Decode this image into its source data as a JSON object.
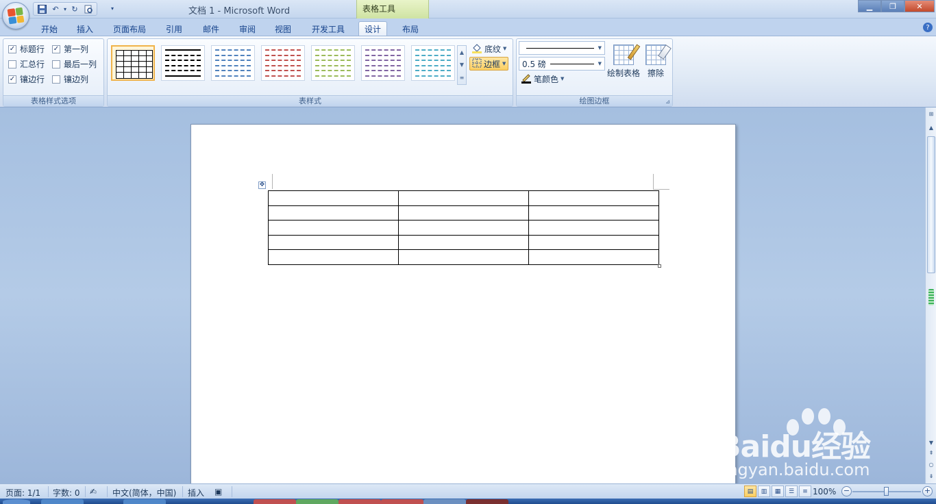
{
  "window": {
    "title": "文档 1 - Microsoft Word",
    "context_tab": "表格工具"
  },
  "tabs": [
    {
      "label": "开始"
    },
    {
      "label": "插入"
    },
    {
      "label": "页面布局"
    },
    {
      "label": "引用"
    },
    {
      "label": "邮件"
    },
    {
      "label": "审阅"
    },
    {
      "label": "视图"
    },
    {
      "label": "开发工具"
    },
    {
      "label": "设计"
    },
    {
      "label": "布局"
    }
  ],
  "active_tab": "设计",
  "ribbon": {
    "style_options": {
      "label": "表格样式选项",
      "checkboxes": [
        {
          "label": "标题行",
          "checked": true
        },
        {
          "label": "第一列",
          "checked": true
        },
        {
          "label": "汇总行",
          "checked": false
        },
        {
          "label": "最后一列",
          "checked": false
        },
        {
          "label": "镶边行",
          "checked": true
        },
        {
          "label": "镶边列",
          "checked": false
        }
      ]
    },
    "table_styles": {
      "label": "表样式",
      "swatches": [
        "#000000",
        "#000000",
        "#4f81bd",
        "#c0504d",
        "#9bbb59",
        "#8064a2",
        "#4bacc6"
      ],
      "shading_label": "底纹",
      "borders_label": "边框"
    },
    "draw_borders": {
      "label": "绘图边框",
      "weight": "0.5 磅",
      "pen_color_label": "笔颜色",
      "draw_table_label": "绘制表格",
      "eraser_label": "擦除"
    }
  },
  "statusbar": {
    "page": "页面: 1/1",
    "words": "字数: 0",
    "language": "中文(简体，中国)",
    "mode": "插入",
    "zoom": "100%"
  },
  "watermark": {
    "brand": "Baidu经验",
    "url": "jingyan.baidu.com"
  }
}
